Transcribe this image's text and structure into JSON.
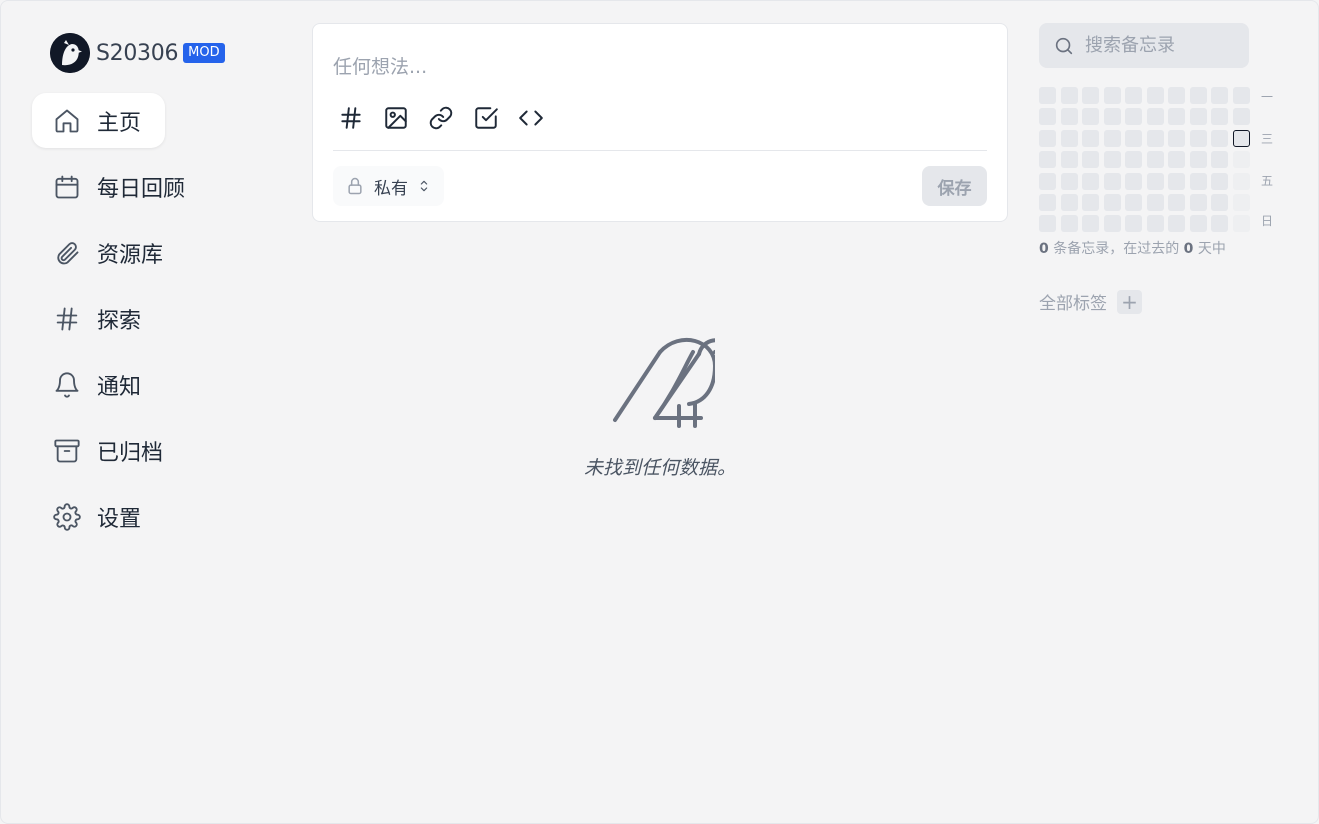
{
  "user": {
    "name": "S20306",
    "badge": "MOD"
  },
  "nav": {
    "home": "主页",
    "daily_review": "每日回顾",
    "resources": "资源库",
    "explore": "探索",
    "notifications": "通知",
    "archived": "已归档",
    "settings": "设置"
  },
  "editor": {
    "placeholder": "任何想法...",
    "visibility": "私有",
    "save_label": "保存"
  },
  "empty_state": {
    "text": "未找到任何数据。"
  },
  "search": {
    "placeholder": "搜索备忘录"
  },
  "heatmap": {
    "weekday_labels": [
      "一",
      "三",
      "五",
      "日"
    ],
    "memo_count": "0",
    "days_count": "0",
    "stats_part1": "条备忘录，在过去的",
    "stats_part2": "天中"
  },
  "tags": {
    "header": "全部标签",
    "add_label": "+"
  },
  "colors": {
    "accent": "#2563eb",
    "background": "#f4f4f5",
    "icon": "#4b5563"
  }
}
